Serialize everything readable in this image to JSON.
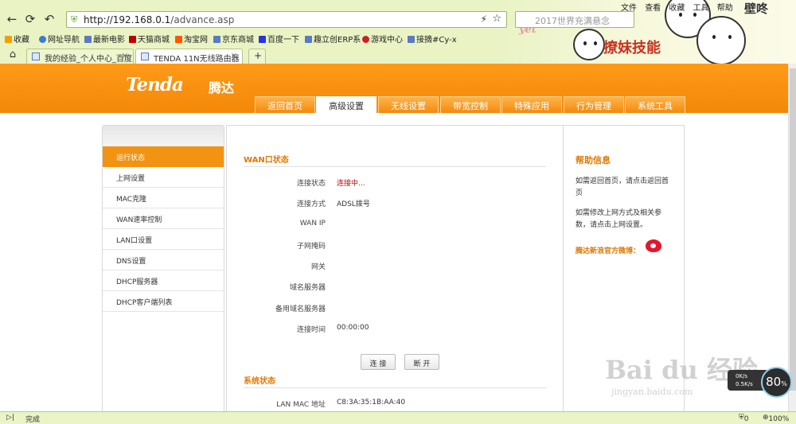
{
  "browser": {
    "url_host": "http://192.168.0.1",
    "url_path": "/advance.asp",
    "search_placeholder": "2017世界充满悬念",
    "menu": [
      "文件",
      "查看",
      "收藏",
      "工具",
      "帮助"
    ],
    "bookmarks": [
      {
        "label": "收藏",
        "color": "#f0a000"
      },
      {
        "label": "网址导航",
        "color": "#3a7bd5"
      },
      {
        "label": "最新电影",
        "color": "#5a7bbf"
      },
      {
        "label": "天猫商城",
        "color": "#c00000"
      },
      {
        "label": "淘宝网",
        "color": "#ff5500"
      },
      {
        "label": "京东商城",
        "color": "#5a7bbf"
      },
      {
        "label": "百度一下",
        "color": "#2932e1"
      },
      {
        "label": "趣立创ERP系",
        "color": "#5a7bbf"
      },
      {
        "label": "游戏中心",
        "color": "#d02020"
      },
      {
        "label": "接摘#Cy-x",
        "color": "#5a7bbf"
      }
    ],
    "tabs": [
      {
        "title": "我的经验_个人中心_百度",
        "close": "×",
        "active": false
      },
      {
        "title": "TENDA 11N无线路由器",
        "close": "×",
        "active": true
      }
    ],
    "new_tab": "+",
    "deco_text": "撩妹技能",
    "deco_text2": "壁咚",
    "deco_script": "yet",
    "status_text": "完成",
    "status_count": "0",
    "zoom": "100%"
  },
  "router": {
    "logo": "Tenda",
    "logo_cn": "腾达",
    "nav_tabs": [
      "返回首页",
      "高级设置",
      "无线设置",
      "带宽控制",
      "特殊应用",
      "行为管理",
      "系统工具"
    ],
    "active_nav": 1,
    "sidebar_items": [
      "运行状态",
      "上网设置",
      "MAC克隆",
      "WAN速率控制",
      "LAN口设置",
      "DNS设置",
      "DHCP服务器",
      "DHCP客户端列表"
    ],
    "active_sidebar": 0,
    "wan_title": "WAN口状态",
    "wan_fields": [
      {
        "label": "连接状态",
        "value": "连接中..."
      },
      {
        "label": "连接方式",
        "value": "ADSL拨号"
      },
      {
        "label": "WAN IP",
        "value": ""
      },
      {
        "label": "子网掩码",
        "value": ""
      },
      {
        "label": "网关",
        "value": ""
      },
      {
        "label": "域名服务器",
        "value": ""
      },
      {
        "label": "备用域名服务器",
        "value": ""
      },
      {
        "label": "连接时间",
        "value": "00:00:00"
      }
    ],
    "connect_label": "连 接",
    "disconnect_label": "断 开",
    "system_title": "系统状态",
    "system_fields": [
      {
        "label": "LAN MAC 地址",
        "value": "C8:3A:35:1B:AA:40"
      }
    ],
    "help_title": "帮助信息",
    "help_p1": "如需返回首页，请点击返回首页",
    "help_p2": "如需修改上网方式及相关参数，请点击上网设置。",
    "weibo_label": "腾达新浪官方微博："
  },
  "overlay": {
    "watermark": "Bai du 经验",
    "watermark_sub": "jingyan.baidu.com",
    "speed_up": "0K/s",
    "speed_down": "0.5K/s",
    "gauge": "80"
  }
}
